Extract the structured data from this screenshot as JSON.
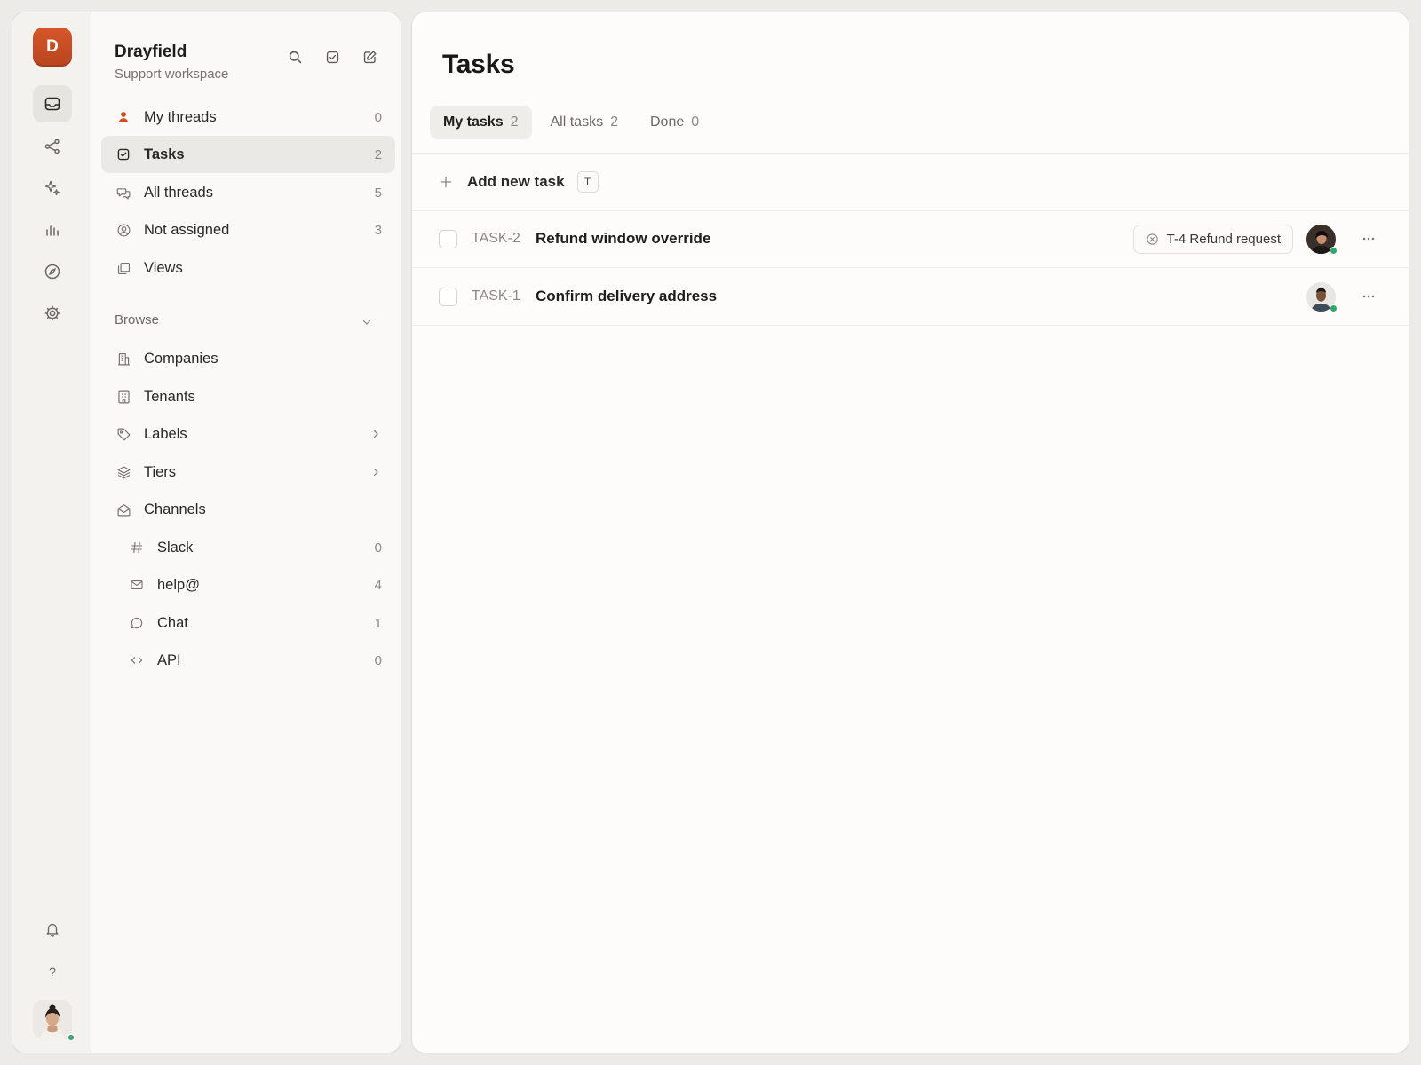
{
  "workspace": {
    "logo_letter": "D",
    "name": "Drayfield",
    "subtitle": "Support workspace"
  },
  "rail": {
    "items": [
      "inbox-icon",
      "share-icon",
      "sparkles-icon",
      "chart-icon",
      "compass-icon",
      "gear-icon"
    ],
    "bottom": [
      "bell-icon",
      "help-icon"
    ],
    "help_label": "?"
  },
  "sidebar": {
    "primary": [
      {
        "label": "My threads",
        "count": "0",
        "icon": "person-icon"
      },
      {
        "label": "Tasks",
        "count": "2",
        "icon": "checkbox-icon",
        "active": true
      },
      {
        "label": "All threads",
        "count": "5",
        "icon": "chat-bubbles-icon"
      },
      {
        "label": "Not assigned",
        "count": "3",
        "icon": "user-circle-icon"
      },
      {
        "label": "Views",
        "icon": "copy-icon"
      }
    ],
    "browse_title": "Browse",
    "browse": [
      {
        "label": "Companies",
        "icon": "building-icon"
      },
      {
        "label": "Tenants",
        "icon": "grid-building-icon"
      },
      {
        "label": "Labels",
        "icon": "tag-icon"
      },
      {
        "label": "Tiers",
        "icon": "layers-icon"
      },
      {
        "label": "Channels",
        "icon": "envelope-open-icon"
      }
    ],
    "channels": [
      {
        "label": "Slack",
        "count": "0",
        "icon": "hash-icon"
      },
      {
        "label": "help@",
        "count": "4",
        "icon": "mail-icon"
      },
      {
        "label": "Chat",
        "count": "1",
        "icon": "chat-icon"
      },
      {
        "label": "API",
        "count": "0",
        "icon": "code-icon"
      }
    ]
  },
  "main": {
    "title": "Tasks",
    "tabs": [
      {
        "label": "My tasks",
        "count": "2",
        "active": true
      },
      {
        "label": "All tasks",
        "count": "2"
      },
      {
        "label": "Done",
        "count": "0"
      }
    ],
    "add_task_label": "Add new task",
    "add_task_shortcut": "T",
    "tasks": [
      {
        "id": "TASK-2",
        "title": "Refund window override",
        "linked_thread": "T-4 Refund request"
      },
      {
        "id": "TASK-1",
        "title": "Confirm delivery address"
      }
    ]
  },
  "colors": {
    "brand": "#c94e24",
    "online": "#2ea86b",
    "active_bg": "#ebe9e5"
  }
}
